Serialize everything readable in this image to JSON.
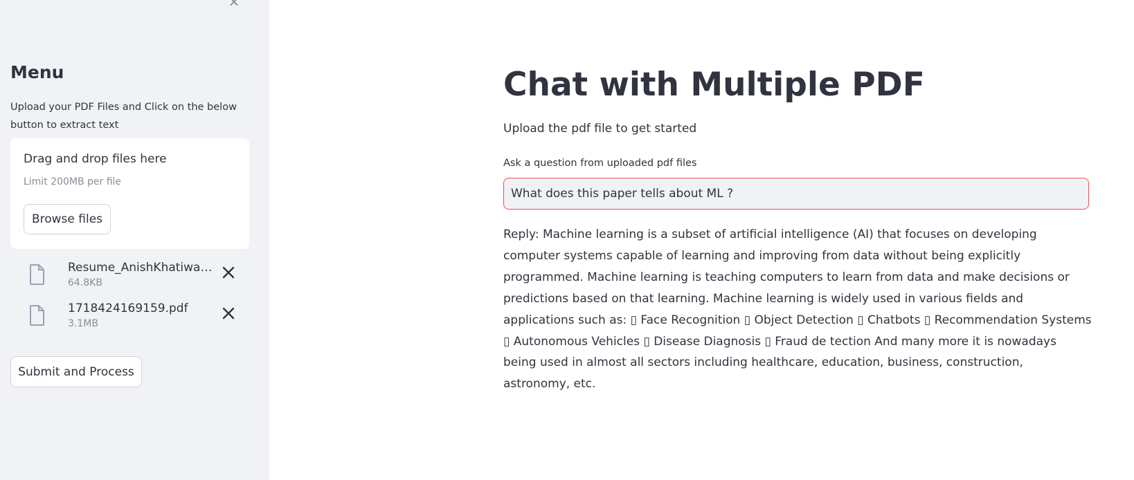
{
  "sidebar": {
    "close_icon": "close-icon",
    "title": "Menu",
    "description": "Upload your PDF Files and Click on the below button to extract text",
    "dropzone": {
      "title": "Drag and drop files here",
      "limit": "Limit 200MB per file",
      "browse_label": "Browse files"
    },
    "files": [
      {
        "name": "Resume_AnishKhatiwada.pdf",
        "size": "64.8KB",
        "icon": "file-icon"
      },
      {
        "name": "1718424169159.pdf",
        "size": "3.1MB",
        "icon": "file-icon"
      }
    ],
    "submit_label": "Submit and Process"
  },
  "main": {
    "title": "Chat with Multiple PDF",
    "subtitle": "Upload the pdf file to get started",
    "question_label": "Ask a question from uploaded pdf files",
    "question_value": "What does this paper tells about ML ?",
    "reply": "Reply: Machine learning is a subset of artificial intelligence (AI) that focuses on developing computer systems capable of learning and improving from data without being explicitly programmed. Machine learning is teaching computers to learn from data and make decisions or predictions based on that learning. Machine learning is widely used in various fields and applications such as: ▯ Face Recognition ▯ Object Detection ▯ Chatbots ▯ Recommendation Systems ▯ Autonomous Vehicles ▯ Disease Diagnosis ▯ Fraud de tection And many more it is nowadays being used in almost all sectors including healthcare, education, business, construction, astronomy, etc."
  },
  "colors": {
    "sidebar_bg": "#f0f2f6",
    "text": "#31333f",
    "muted": "#8b8d98",
    "input_focus_border": "#ff4b4b"
  }
}
